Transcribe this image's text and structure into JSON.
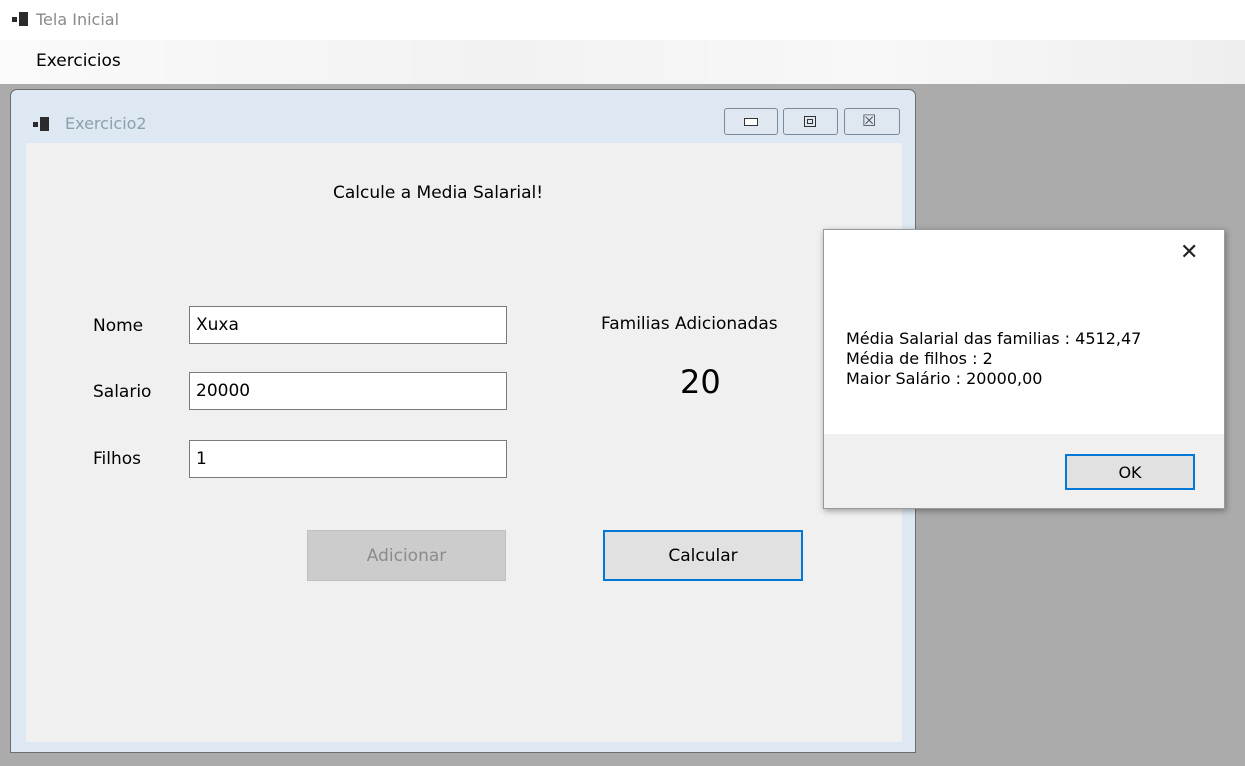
{
  "outer_window": {
    "title": "Tela Inicial",
    "icon": "app-window-icon"
  },
  "menubar": {
    "items": [
      {
        "label": "Exercicios"
      }
    ]
  },
  "child_window": {
    "title": "Exercicio2",
    "icon": "app-window-icon",
    "controls": {
      "minimize": "minimize-icon",
      "maximize": "maximize-icon",
      "close": "close-icon"
    }
  },
  "form": {
    "heading": "Calcule a Media Salarial!",
    "fields": [
      {
        "label": "Nome",
        "value": "Xuxa"
      },
      {
        "label": "Salario",
        "value": "20000"
      },
      {
        "label": "Filhos",
        "value": "1"
      }
    ],
    "families_label": "Familias Adicionadas",
    "families_count": "20",
    "add_button": "Adicionar",
    "add_button_enabled": false,
    "calc_button": "Calcular"
  },
  "message_box": {
    "close_glyph": "✕",
    "lines": [
      "Média Salarial das familias : 4512,47",
      "Média de filhos : 2",
      "Maior Salário : 20000,00"
    ],
    "ok_button": "OK"
  },
  "colors": {
    "accent": "#0078d7",
    "mdi_background": "#ababab",
    "form_background": "#f0f0f0"
  }
}
